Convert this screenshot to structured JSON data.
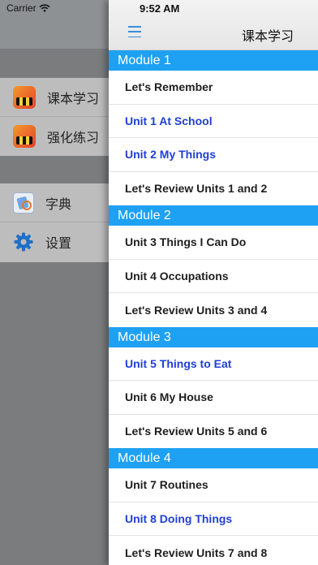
{
  "status_bar": {
    "carrier": "Carrier",
    "time": "9:52 AM"
  },
  "side_menu": {
    "groups": [
      [
        {
          "label": "课本学习",
          "icon": "app-icon"
        },
        {
          "label": "强化练习",
          "icon": "app-icon"
        }
      ],
      [
        {
          "label": "字典",
          "icon": "dictionary-icon"
        },
        {
          "label": "设置",
          "icon": "gear-icon"
        }
      ]
    ]
  },
  "nav": {
    "title": "课本学习",
    "menu_icon": "hamburger-icon"
  },
  "modules": [
    {
      "title": "Module 1",
      "units": [
        {
          "label": "Let's Remember",
          "highlight": false
        },
        {
          "label": "Unit 1 At School",
          "highlight": true
        },
        {
          "label": "Unit 2 My Things",
          "highlight": true
        },
        {
          "label": "Let's Review Units 1 and 2",
          "highlight": false
        }
      ]
    },
    {
      "title": "Module 2",
      "units": [
        {
          "label": "Unit 3 Things I Can Do",
          "highlight": false
        },
        {
          "label": "Unit 4 Occupations",
          "highlight": false
        },
        {
          "label": "Let's Review Units 3 and 4",
          "highlight": false
        }
      ]
    },
    {
      "title": "Module 3",
      "units": [
        {
          "label": "Unit 5 Things to Eat",
          "highlight": true
        },
        {
          "label": "Unit 6 My House",
          "highlight": false
        },
        {
          "label": "Let's Review Units 5 and 6",
          "highlight": false
        }
      ]
    },
    {
      "title": "Module 4",
      "units": [
        {
          "label": "Unit 7 Routines",
          "highlight": false
        },
        {
          "label": "Unit 8 Doing Things",
          "highlight": true
        },
        {
          "label": "Let's Review Units 7 and 8",
          "highlight": false
        }
      ]
    }
  ],
  "colors": {
    "section_header": "#1ea1f2",
    "link_blue": "#1f3fd6",
    "accent": "#3a8fd9"
  }
}
